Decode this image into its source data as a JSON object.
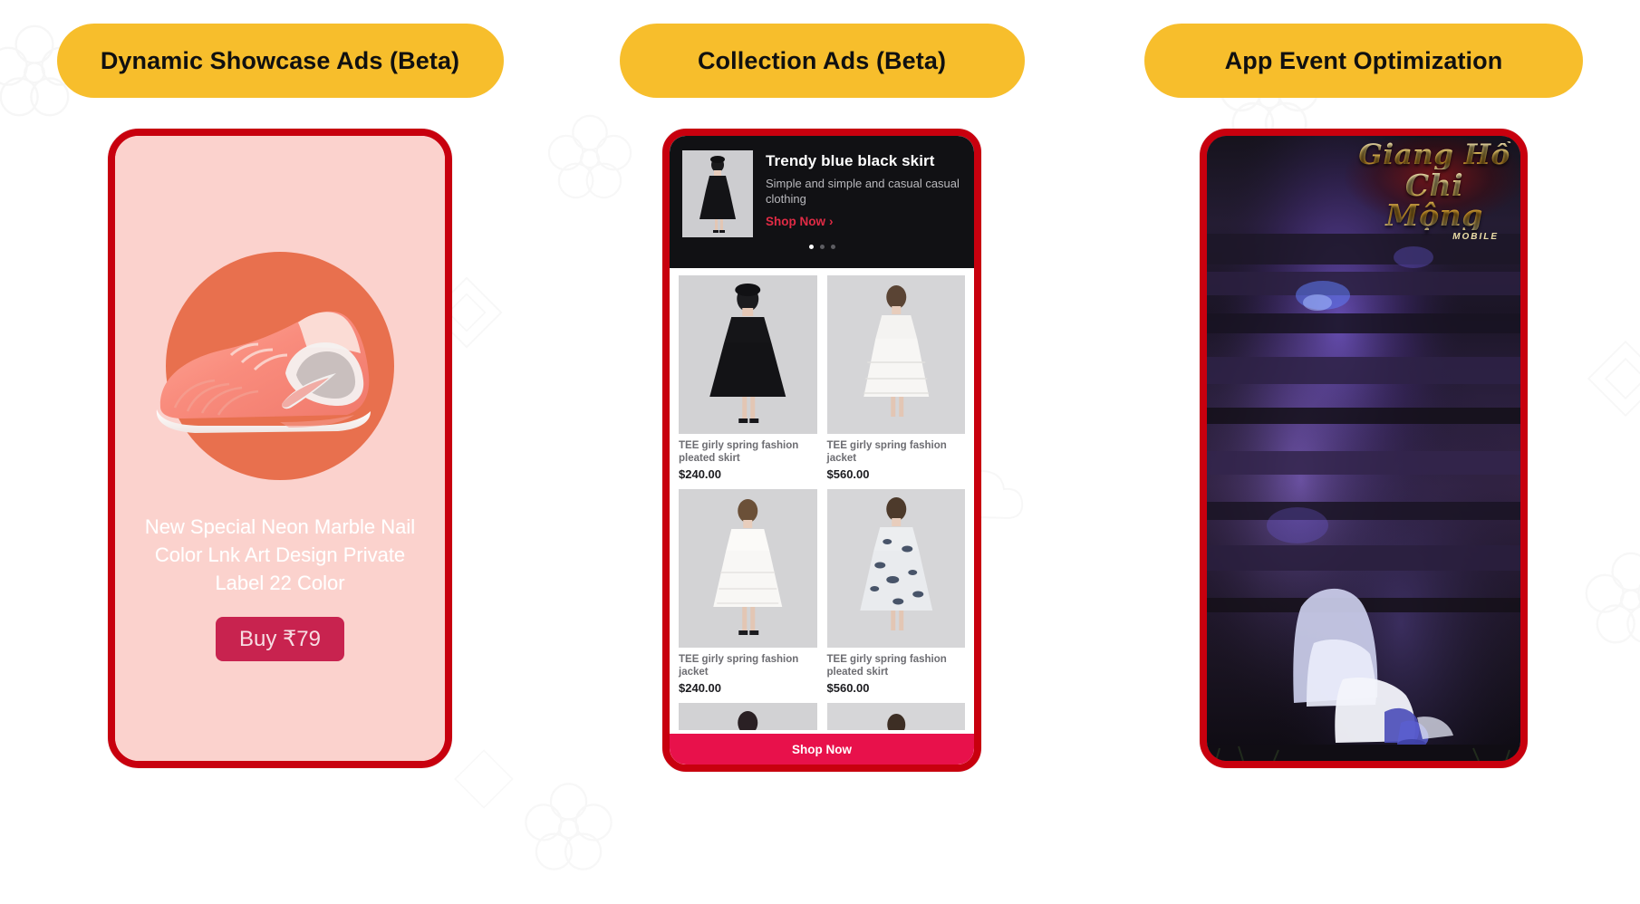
{
  "page": {
    "background_color": "#ffffff",
    "accent_yellow": "#F7BE2C",
    "frame_red": "#C8000E"
  },
  "columns": [
    {
      "header": {
        "label": "Dynamic Showcase Ads (Beta)"
      },
      "creative": {
        "type": "dynamic-showcase-ad",
        "background_color": "#FBD2CD",
        "circle_color": "#E8704E",
        "product_image": "nike-air-max-720-coral-sneaker",
        "title": "New Special Neon Marble Nail Color Lnk Art  Design Private Label 22 Color",
        "cta_label": "Buy ₹79",
        "cta_color": "#C8234F"
      }
    },
    {
      "header": {
        "label": "Collection Ads (Beta)"
      },
      "creative": {
        "type": "collection-ad",
        "banner": {
          "thumbnail": "black-dress-model-thumbnail",
          "title": "Trendy blue black skirt",
          "subtitle": "Simple and simple and casual casual clothing",
          "link_label": "Shop Now",
          "link_color": "#E02B45",
          "carousel_dots": 3,
          "carousel_active_index": 0
        },
        "products": [
          {
            "name": "TEE girly spring fashion pleated skirt",
            "price": "$240.00",
            "image": "model-black-pleated-dress"
          },
          {
            "name": "TEE girly spring fashion jacket",
            "price": "$560.00",
            "image": "model-white-lace-dress"
          },
          {
            "name": "TEE girly spring fashion jacket",
            "price": "$240.00",
            "image": "model-white-summer-dress"
          },
          {
            "name": "TEE girly spring fashion pleated skirt",
            "price": "$560.00",
            "image": "model-floral-print-dress"
          }
        ],
        "cta_label": "Shop Now",
        "cta_color": "#E8114B"
      }
    },
    {
      "header": {
        "label": "App Event Optimization"
      },
      "creative": {
        "type": "app-event-optimization",
        "media": "game-trailer-video-still",
        "logo": {
          "line1": "Giang Hồ",
          "line2": "Chi Mộng",
          "tagline": "MOBILE"
        }
      }
    }
  ]
}
